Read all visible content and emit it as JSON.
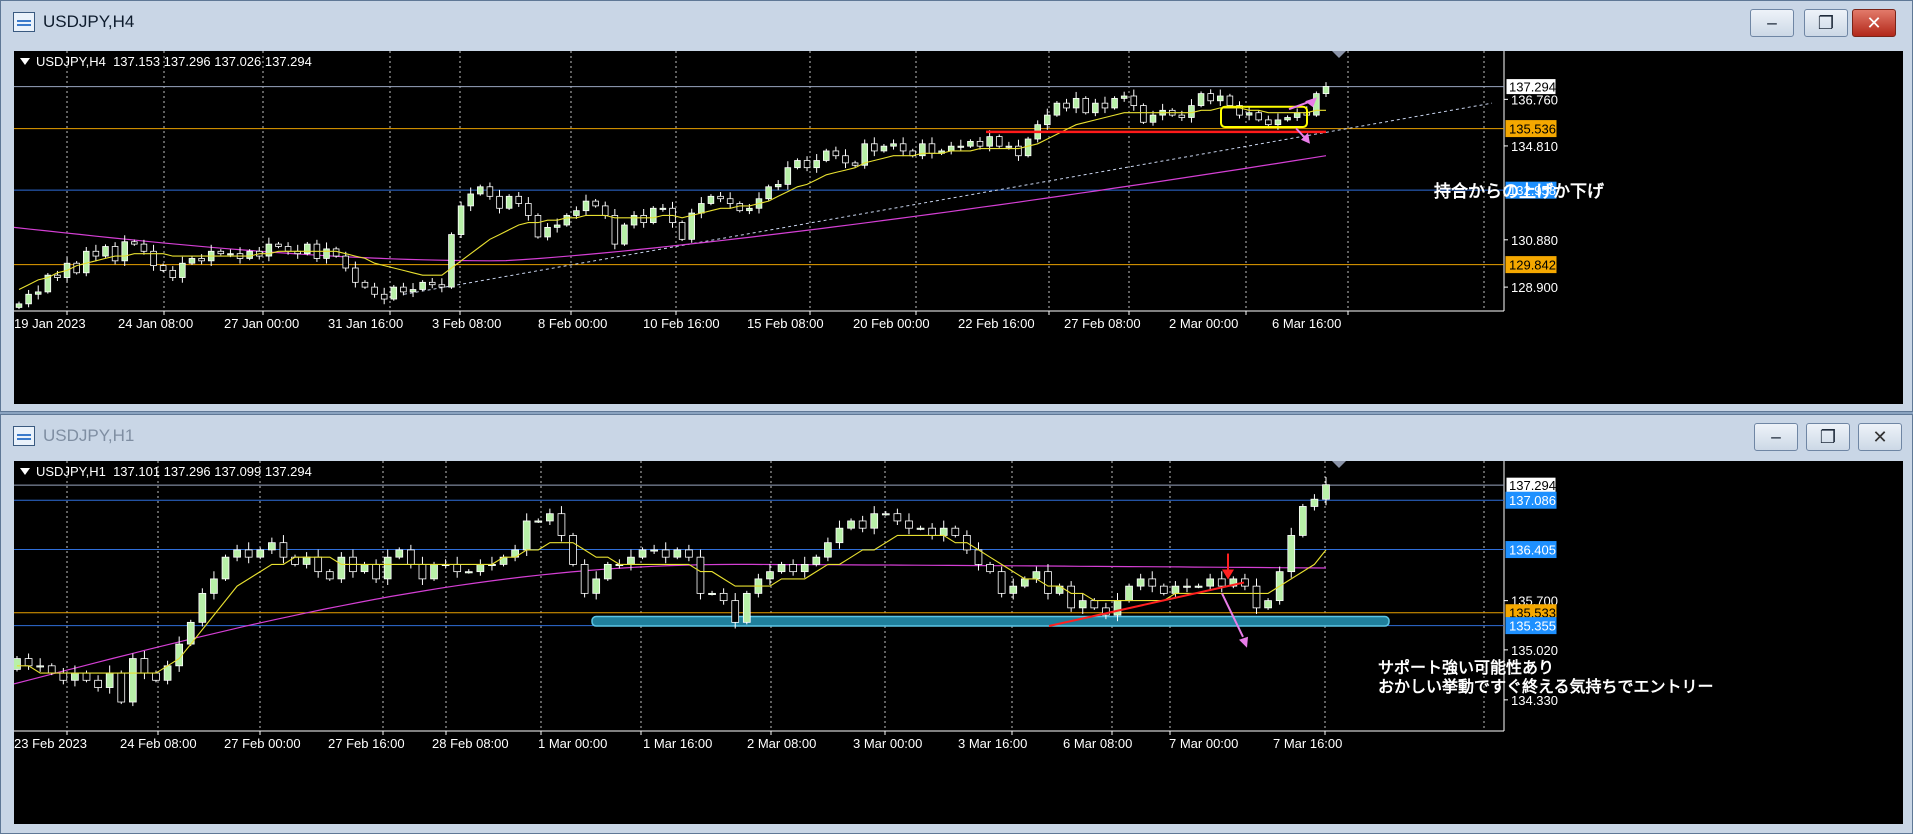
{
  "windows": [
    {
      "title": "USDJPY,H4",
      "header": "USDJPY,H4  137.153 137.296 137.026 137.294",
      "annotation": "持合からの上げか下げ",
      "chart_data": {
        "type": "candlestick",
        "symbol": "USDJPY",
        "timeframe": "H4",
        "ohlc": {
          "open": 137.153,
          "high": 137.296,
          "low": 137.026,
          "close": 137.294
        },
        "y_range": [
          127.9,
          138.7
        ],
        "x_tick_labels": [
          "19 Jan 2023",
          "24 Jan 08:00",
          "27 Jan 00:00",
          "31 Jan 16:00",
          "3 Feb 08:00",
          "8 Feb 00:00",
          "10 Feb 16:00",
          "15 Feb 08:00",
          "20 Feb 00:00",
          "22 Feb 16:00",
          "27 Feb 08:00",
          "2 Mar 00:00",
          "6 Mar 16:00"
        ],
        "y_tick_labels": [
          "136.760",
          "134.810",
          "130.880",
          "128.900"
        ],
        "price_lines": [
          {
            "label": "137.294",
            "value": 137.294,
            "color": "#9aa6c0",
            "badge_bg": "#ffffff",
            "badge_fg": "#000000"
          },
          {
            "label": "135.536",
            "value": 135.536,
            "color": "#e8a000",
            "badge_bg": "#f5a800",
            "badge_fg": "#000000"
          },
          {
            "label": "132.958",
            "value": 132.958,
            "color": "#2f6ed8",
            "badge_bg": "#1e90ff",
            "badge_fg": "#ffffff"
          },
          {
            "label": "129.842",
            "value": 129.842,
            "color": "#e8a000",
            "badge_bg": "#f5a800",
            "badge_fg": "#000000"
          }
        ],
        "closes": [
          128.2,
          128.6,
          128.7,
          129.4,
          129.3,
          129.9,
          129.5,
          130.4,
          130.2,
          130.6,
          130.0,
          130.8,
          130.7,
          130.4,
          129.8,
          129.6,
          129.3,
          129.9,
          130.1,
          130.0,
          130.4,
          130.3,
          130.3,
          130.1,
          130.4,
          130.2,
          130.7,
          130.6,
          130.4,
          130.3,
          130.7,
          130.1,
          130.5,
          130.2,
          129.7,
          129.1,
          128.9,
          128.6,
          128.4,
          128.9,
          128.7,
          128.8,
          129.1,
          129.0,
          128.9,
          131.1,
          132.3,
          132.8,
          133.1,
          132.7,
          132.2,
          132.7,
          132.4,
          131.9,
          131.0,
          131.4,
          131.5,
          131.9,
          132.1,
          132.5,
          132.3,
          131.9,
          130.7,
          131.5,
          131.9,
          131.6,
          132.2,
          132.2,
          131.6,
          130.9,
          132.0,
          132.4,
          132.7,
          132.6,
          132.4,
          132.1,
          132.2,
          132.6,
          133.1,
          133.2,
          133.9,
          134.2,
          133.9,
          134.2,
          134.6,
          134.4,
          134.1,
          134.0,
          134.9,
          134.6,
          134.8,
          134.9,
          134.6,
          134.4,
          134.9,
          134.5,
          134.6,
          134.8,
          134.8,
          135.0,
          134.8,
          135.2,
          134.8,
          134.8,
          134.4,
          135.1,
          135.7,
          136.1,
          136.6,
          136.4,
          136.8,
          136.2,
          136.6,
          136.4,
          136.8,
          136.9,
          136.5,
          135.8,
          136.1,
          136.3,
          136.1,
          136.0,
          136.5,
          137.0,
          136.7,
          136.9,
          136.5,
          136.1,
          136.2,
          135.9,
          135.7,
          135.9,
          136.0,
          136.2,
          136.1,
          137.0,
          137.3
        ],
        "ma_yellow": [
          128.8,
          129.0,
          129.2,
          129.3,
          129.5,
          129.6,
          129.8,
          129.9,
          130.0,
          130.1,
          130.2,
          130.2,
          130.3,
          130.3,
          130.3,
          130.3,
          130.2,
          130.2,
          130.2,
          130.2,
          130.2,
          130.2,
          130.2,
          130.2,
          130.2,
          130.3,
          130.3,
          130.4,
          130.4,
          130.4,
          130.4,
          130.4,
          130.4,
          130.4,
          130.3,
          130.2,
          130.1,
          129.9,
          129.8,
          129.7,
          129.6,
          129.5,
          129.4,
          129.4,
          129.4,
          129.7,
          130.0,
          130.3,
          130.6,
          130.9,
          131.1,
          131.3,
          131.5,
          131.6,
          131.6,
          131.7,
          131.7,
          131.8,
          131.8,
          131.9,
          131.9,
          131.9,
          131.8,
          131.8,
          131.8,
          131.8,
          131.8,
          131.9,
          131.9,
          131.8,
          131.9,
          132.0,
          132.1,
          132.2,
          132.2,
          132.3,
          132.3,
          132.4,
          132.5,
          132.7,
          132.9,
          133.1,
          133.2,
          133.4,
          133.6,
          133.7,
          133.8,
          133.9,
          134.1,
          134.2,
          134.3,
          134.4,
          134.4,
          134.4,
          134.5,
          134.5,
          134.5,
          134.6,
          134.6,
          134.6,
          134.7,
          134.7,
          134.7,
          134.7,
          134.7,
          134.8,
          134.9,
          135.1,
          135.3,
          135.5,
          135.7,
          135.8,
          135.9,
          136.0,
          136.1,
          136.2,
          136.2,
          136.2,
          136.2,
          136.2,
          136.2,
          136.2,
          136.2,
          136.3,
          136.3,
          136.4,
          136.4,
          136.4,
          136.3,
          136.3,
          136.2,
          136.2,
          136.2,
          136.2,
          136.2,
          136.3,
          136.3
        ],
        "ma_magenta": {
          "start": 131.4,
          "mid": 130.0,
          "mid_at": 0.37,
          "end": 134.4
        },
        "trend_line": {
          "from_value": 128.6,
          "to_value": 136.6
        },
        "support_line": 135.4
      }
    },
    {
      "title": "USDJPY,H1",
      "header": "USDJPY,H1  137.101 137.296 137.099 137.294",
      "annotation_1": "サポート強い可能性あり",
      "annotation_2": "おかしい挙動ですぐ終える気持ちでエントリー",
      "chart_data": {
        "type": "candlestick",
        "symbol": "USDJPY",
        "timeframe": "H1",
        "ohlc": {
          "open": 137.101,
          "high": 137.296,
          "low": 137.099,
          "close": 137.294
        },
        "y_range": [
          133.9,
          137.6
        ],
        "x_tick_labels": [
          "23 Feb 2023",
          "24 Feb 08:00",
          "27 Feb 00:00",
          "27 Feb 16:00",
          "28 Feb 08:00",
          "1 Mar 00:00",
          "1 Mar 16:00",
          "2 Mar 08:00",
          "3 Mar 00:00",
          "3 Mar 16:00",
          "6 Mar 08:00",
          "7 Mar 00:00",
          "7 Mar 16:00"
        ],
        "y_tick_labels": [
          "135.700",
          "135.020",
          "134.330"
        ],
        "price_lines": [
          {
            "label": "137.294",
            "value": 137.294,
            "color": "#9aa6c0",
            "badge_bg": "#ffffff",
            "badge_fg": "#000000"
          },
          {
            "label": "137.086",
            "value": 137.086,
            "color": "#2f6ed8",
            "badge_bg": "#1e90ff",
            "badge_fg": "#ffffff"
          },
          {
            "label": "136.405",
            "value": 136.405,
            "color": "#2f6ed8",
            "badge_bg": "#1e90ff",
            "badge_fg": "#ffffff"
          },
          {
            "label": "135.533",
            "value": 135.533,
            "color": "#e8a000",
            "badge_bg": "#f5a800",
            "badge_fg": "#000000"
          },
          {
            "label": "135.355",
            "value": 135.355,
            "color": "#2f6ed8",
            "badge_bg": "#1e90ff",
            "badge_fg": "#ffffff"
          }
        ],
        "closes": [
          134.9,
          134.8,
          134.8,
          134.7,
          134.6,
          134.7,
          134.6,
          134.5,
          134.7,
          134.3,
          134.9,
          134.7,
          134.6,
          134.8,
          135.1,
          135.4,
          135.8,
          136.0,
          136.3,
          136.4,
          136.3,
          136.4,
          136.5,
          136.3,
          136.2,
          136.3,
          136.1,
          136.0,
          136.3,
          136.1,
          136.2,
          136.0,
          136.3,
          136.4,
          136.2,
          136.0,
          136.2,
          136.2,
          136.1,
          136.1,
          136.2,
          136.2,
          136.3,
          136.4,
          136.8,
          136.8,
          136.9,
          136.6,
          136.2,
          135.8,
          136.0,
          136.2,
          136.2,
          136.3,
          136.4,
          136.4,
          136.3,
          136.4,
          136.3,
          135.8,
          135.8,
          135.7,
          135.4,
          135.8,
          136.0,
          136.1,
          136.2,
          136.1,
          136.2,
          136.3,
          136.5,
          136.7,
          136.8,
          136.7,
          136.9,
          136.9,
          136.8,
          136.7,
          136.7,
          136.6,
          136.7,
          136.6,
          136.4,
          136.2,
          136.1,
          135.8,
          135.9,
          136.0,
          136.1,
          135.8,
          135.9,
          135.6,
          135.7,
          135.6,
          135.5,
          135.7,
          135.9,
          136.0,
          135.9,
          135.8,
          135.9,
          135.9,
          135.9,
          136.0,
          135.9,
          136.0,
          135.9,
          135.6,
          135.7,
          136.1,
          136.6,
          137.0,
          137.1,
          137.3
        ],
        "ma_yellow": [
          134.8,
          134.8,
          134.7,
          134.7,
          134.7,
          134.7,
          134.7,
          134.7,
          134.7,
          134.7,
          134.7,
          134.7,
          134.7,
          134.8,
          134.9,
          135.1,
          135.3,
          135.5,
          135.7,
          135.9,
          136.0,
          136.1,
          136.2,
          136.2,
          136.3,
          136.3,
          136.3,
          136.3,
          136.2,
          136.2,
          136.2,
          136.2,
          136.2,
          136.2,
          136.2,
          136.2,
          136.2,
          136.2,
          136.2,
          136.2,
          136.2,
          136.2,
          136.3,
          136.3,
          136.4,
          136.4,
          136.5,
          136.5,
          136.5,
          136.4,
          136.3,
          136.3,
          136.2,
          136.2,
          136.2,
          136.2,
          136.2,
          136.2,
          136.2,
          136.1,
          136.1,
          136.0,
          135.9,
          135.9,
          135.9,
          135.9,
          136.0,
          136.0,
          136.0,
          136.1,
          136.2,
          136.2,
          136.3,
          136.4,
          136.4,
          136.5,
          136.6,
          136.6,
          136.6,
          136.6,
          136.6,
          136.5,
          136.5,
          136.4,
          136.3,
          136.2,
          136.1,
          136.0,
          136.0,
          135.9,
          135.9,
          135.8,
          135.8,
          135.7,
          135.7,
          135.7,
          135.7,
          135.7,
          135.7,
          135.7,
          135.8,
          135.8,
          135.8,
          135.8,
          135.8,
          135.8,
          135.8,
          135.8,
          135.8,
          135.9,
          136.0,
          136.1,
          136.2,
          136.4
        ],
        "ma_magenta": {
          "start": 134.55,
          "mid": 136.2,
          "mid_at": 0.55,
          "end": 136.15
        },
        "support_zone": [
          135.35,
          135.48
        ]
      }
    }
  ]
}
